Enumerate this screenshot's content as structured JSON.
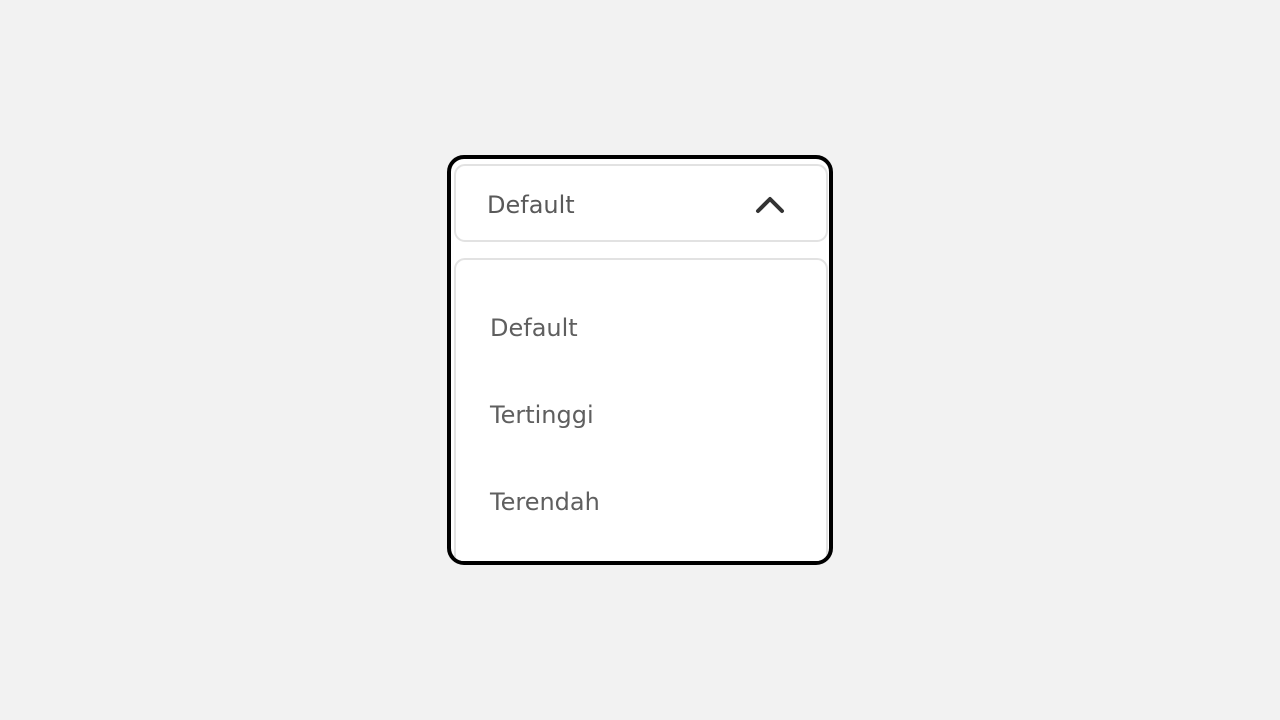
{
  "select": {
    "selected_value": "Default",
    "expanded": true,
    "toggle_icon": "chevron-up-icon"
  },
  "options": [
    {
      "label": "Default"
    },
    {
      "label": "Tertinggi"
    },
    {
      "label": "Terendah"
    }
  ],
  "colors": {
    "page_background": "#f2f2f2",
    "frame_border": "#000000",
    "control_border": "#e2e2e2",
    "text": "#595959",
    "icon": "#333333"
  }
}
